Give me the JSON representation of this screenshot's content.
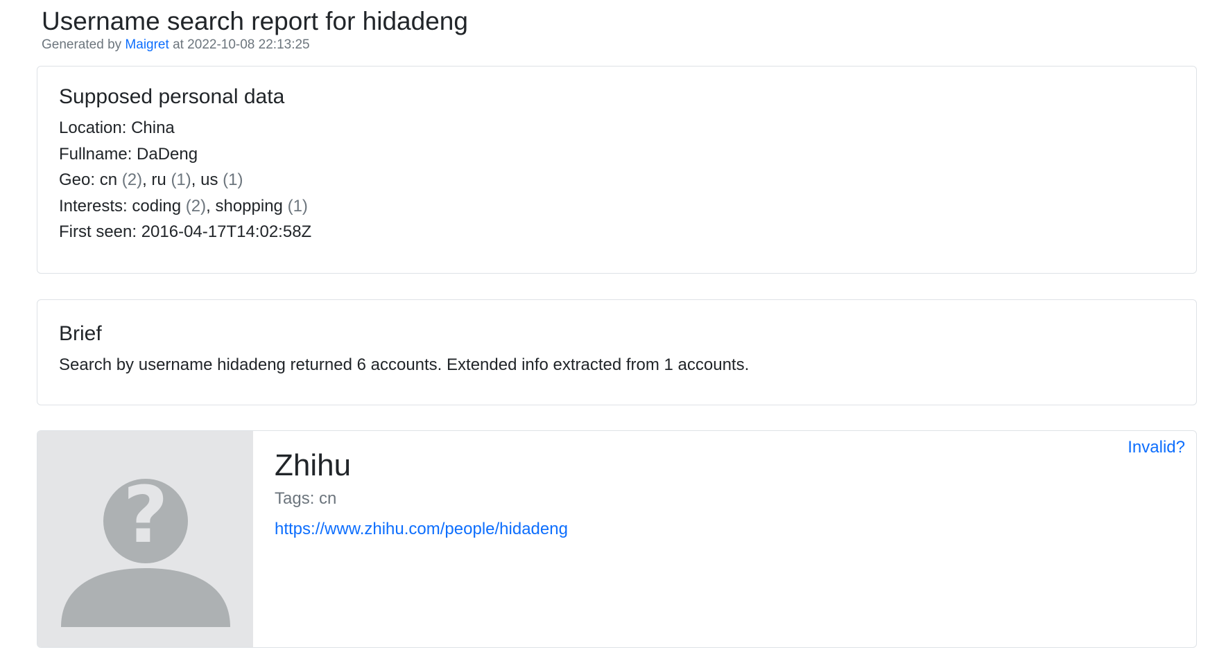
{
  "header": {
    "title": "Username search report for hidadeng",
    "generated_prefix": "Generated by",
    "generator_link": "Maigret",
    "generated_suffix": "at 2022-10-08 22:13:25"
  },
  "personal": {
    "title": "Supposed personal data",
    "location_label": "Location: China",
    "fullname_label": "Fullname: DaDeng",
    "geo_prefix": "Geo:",
    "geo": [
      {
        "name": "cn",
        "count": "(2)"
      },
      {
        "name": "ru",
        "count": "(1)"
      },
      {
        "name": "us",
        "count": "(1)"
      }
    ],
    "interests_prefix": "Interests:",
    "interests": [
      {
        "name": "coding",
        "count": "(2)"
      },
      {
        "name": "shopping",
        "count": "(1)"
      }
    ],
    "first_seen": "First seen: 2016-04-17T14:02:58Z"
  },
  "brief": {
    "title": "Brief",
    "text": "Search by username hidadeng returned 6 accounts. Extended info extracted from 1 accounts."
  },
  "account": {
    "site": "Zhihu",
    "tags": "Tags: cn",
    "url": "https://www.zhihu.com/people/hidadeng",
    "invalid_label": "Invalid?",
    "avatar_icon": "unknown-person-icon"
  }
}
